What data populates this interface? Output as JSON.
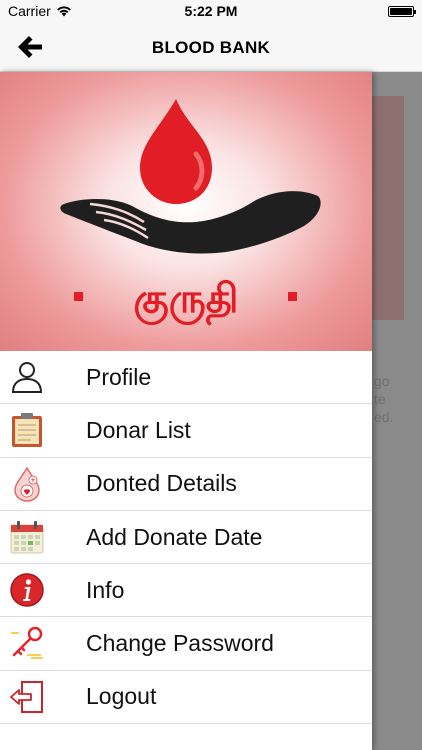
{
  "status_bar": {
    "carrier": "Carrier",
    "time": "5:22 PM"
  },
  "nav": {
    "title": "BLOOD BANK"
  },
  "header": {
    "logo_text": "குருதி",
    "brand_color": "#e11d25"
  },
  "menu": [
    {
      "label": "Profile",
      "icon": "user-icon"
    },
    {
      "label": "Donar List",
      "icon": "clipboard-icon"
    },
    {
      "label": "Donted Details",
      "icon": "blood-drop-icon"
    },
    {
      "label": "Add Donate Date",
      "icon": "calendar-icon"
    },
    {
      "label": "Info",
      "icon": "info-icon"
    },
    {
      "label": "Change Password",
      "icon": "key-icon"
    },
    {
      "label": "Logout",
      "icon": "logout-icon"
    }
  ],
  "background_text": [
    "go",
    "te",
    "ed."
  ]
}
